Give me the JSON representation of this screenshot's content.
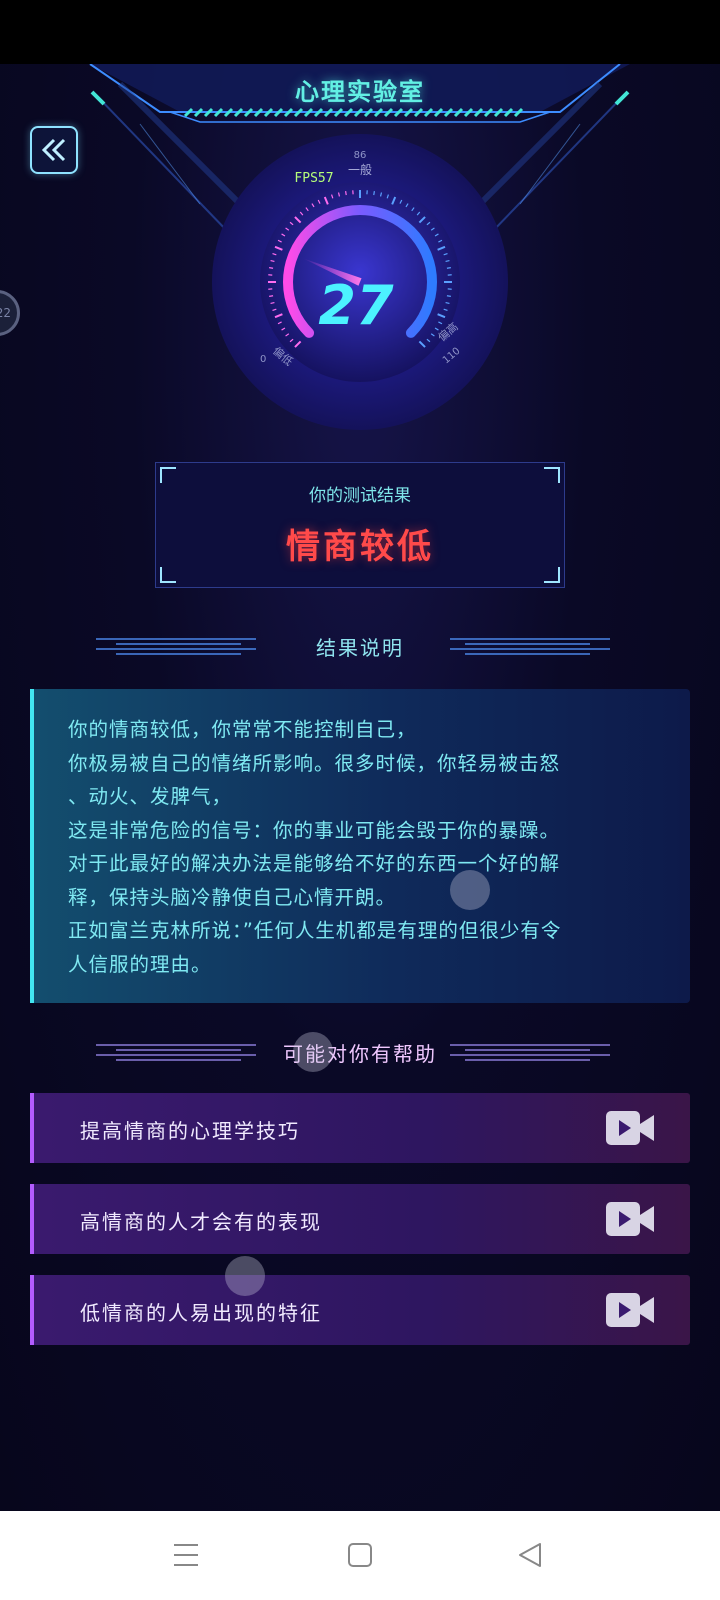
{
  "app": {
    "title": "心理实验室",
    "side_handle_text": "22"
  },
  "gauge": {
    "fps_label": "FPS57",
    "value": "27",
    "top_label": "一般",
    "top_mark": "86",
    "left_label": "偏低",
    "left_value": "0",
    "right_label": "偏高",
    "right_value": "110",
    "level_fraction": 0.25
  },
  "result": {
    "label": "你的测试结果",
    "value": "情商较低"
  },
  "explanation": {
    "heading": "结果说明",
    "lines": [
      "你的情商较低，你常常不能控制自己，",
      "你极易被自己的情绪所影响。很多时候，你轻易被击怒",
      "、动火、发脾气，",
      "这是非常危险的信号：你的事业可能会毁于你的暴躁。",
      "对于此最好的解决办法是能够给不好的东西一个好的解",
      "释，保持头脑冷静使自己心情开朗。",
      "正如富兰克林所说：”任何人生机都是有理的但很少有令",
      "人信服的理由。"
    ]
  },
  "help": {
    "heading": "可能对你有帮助",
    "items": [
      {
        "label": "提高情商的心理学技巧",
        "icon": "video-camera-icon"
      },
      {
        "label": "高情商的人才会有的表现",
        "icon": "video-camera-icon"
      },
      {
        "label": "低情商的人易出现的特征",
        "icon": "video-camera-icon"
      }
    ]
  },
  "nav": {
    "icons": [
      "menu-icon",
      "home-icon",
      "back-triangle-icon"
    ]
  },
  "colors": {
    "title": "#62f0e4",
    "result_value": "#ff4a4a",
    "explanation_text": "#7fe9f2",
    "help_heading": "#f0c8ff",
    "help_accent": "#b35cff",
    "card_accent": "#42e6f2"
  }
}
